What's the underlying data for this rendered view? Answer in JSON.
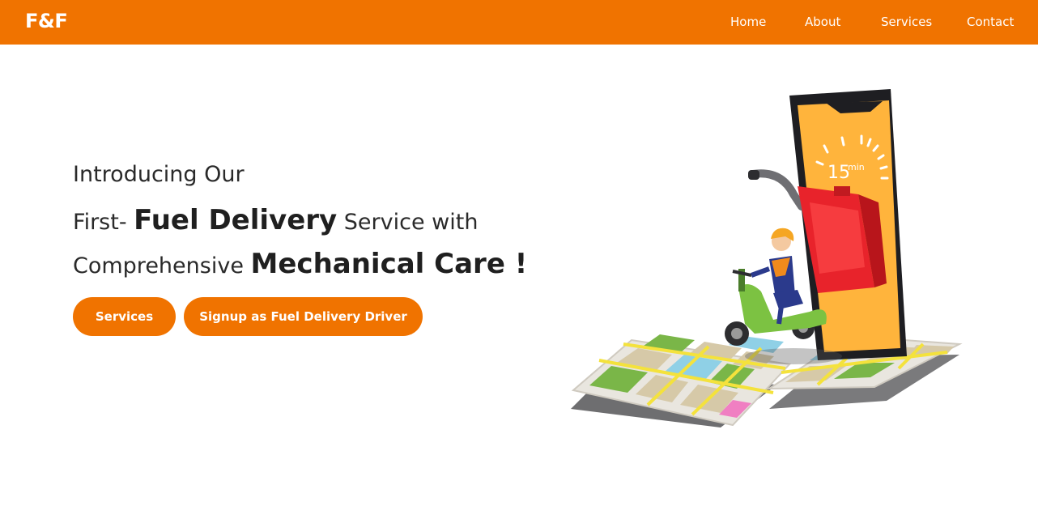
{
  "nav": {
    "brand": "F&F",
    "links": [
      "Home",
      "About",
      "Services",
      "Contact"
    ]
  },
  "hero": {
    "line1": "Introducing Our",
    "line2_prefix": "First- ",
    "line2_bold": "Fuel Delivery",
    "line2_suffix": " Service with",
    "line3_prefix": "Comprehensive ",
    "line3_bold": "Mechanical Care !"
  },
  "buttons": {
    "services": "Services",
    "signup": "Signup as Fuel Delivery Driver"
  },
  "illustration": {
    "phone_timer": "15",
    "phone_timer_unit": "min"
  },
  "colors": {
    "accent": "#f07300",
    "phone_screen": "#ffb43c",
    "fuel_can": "#e8232b",
    "scooter": "#7cc242",
    "map_green": "#7ab648",
    "map_road": "#f4e23c"
  }
}
